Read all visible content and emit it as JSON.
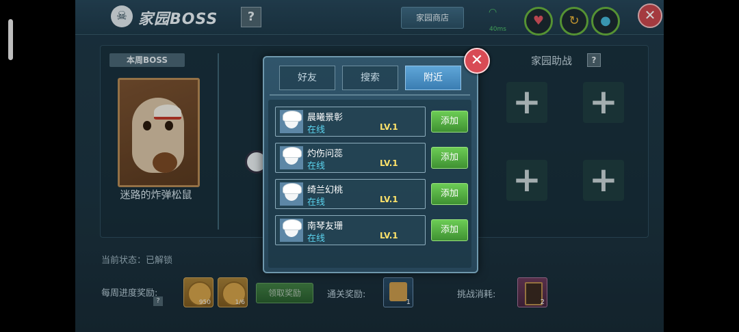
{
  "header": {
    "title": "家园BOSS",
    "help_label": "?",
    "shop_label": "家园商店",
    "network": "40ms",
    "close_label": "✕"
  },
  "boss": {
    "week_tag": "本周BOSS",
    "name": "迷路的炸弹松鼠"
  },
  "status": {
    "text": "当前状态：已解锁"
  },
  "rewards": {
    "weekly_label": "每周进度奖励:",
    "weekly_help": "?",
    "coin_qty_1": "950",
    "coin_qty_2": "1/6",
    "claim_label": "领取奖励",
    "clear_label": "通关奖励:",
    "clear_item_qty": "1",
    "cost_label": "挑战消耗:",
    "cost_item_qty": "2"
  },
  "assist": {
    "title": "家园助战",
    "help": "?",
    "slot_symbol": "+"
  },
  "dialog": {
    "tabs": [
      "好友",
      "搜索",
      "附近"
    ],
    "active_tab": 2,
    "close_label": "✕",
    "add_label": "添加",
    "players": [
      {
        "name": "晨曦景彰",
        "status": "在线",
        "level": "LV.1"
      },
      {
        "name": "灼伤问蕊",
        "status": "在线",
        "level": "LV.1"
      },
      {
        "name": "绮兰幻桃",
        "status": "在线",
        "level": "LV.1"
      },
      {
        "name": "南琴友珊",
        "status": "在线",
        "level": "LV.1"
      }
    ]
  },
  "icons": {
    "heart": "heart-icon",
    "refresh": "refresh-icon",
    "drop": "water-drop-icon"
  },
  "colors": {
    "accent_green": "#6ccc55",
    "online_cyan": "#5bd3ee",
    "level_yellow": "#ffe36a",
    "close_red": "#d84b55"
  }
}
